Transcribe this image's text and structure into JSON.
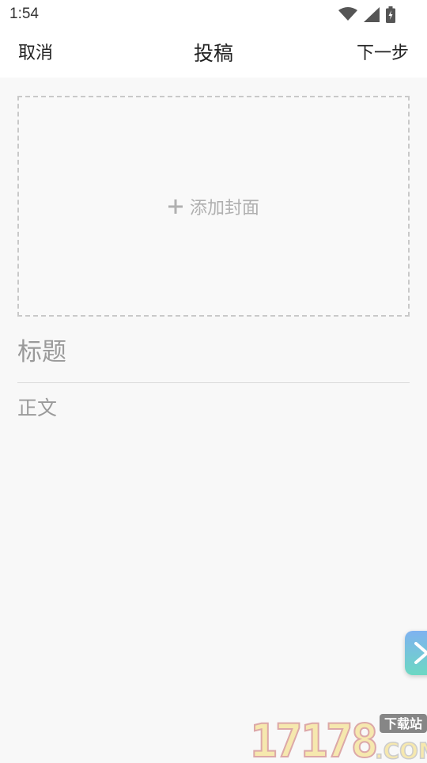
{
  "status_bar": {
    "time": "1:54",
    "icons": [
      "wifi-icon",
      "cell-signal-icon",
      "battery-charging-icon"
    ]
  },
  "header": {
    "cancel_label": "取消",
    "title": "投稿",
    "next_label": "下一步"
  },
  "cover": {
    "label": "添加封面",
    "icon": "plus-icon"
  },
  "editor": {
    "title_placeholder": "标题",
    "body_placeholder": "正文"
  },
  "floating_button": {
    "icon": "chevron-right-icon"
  },
  "watermark": {
    "text_main": "17178",
    "text_badge": "下载站",
    "text_com": ".COM"
  },
  "colors": {
    "background": "#f8f8f8",
    "header_bg": "#ffffff",
    "dashed_border": "#c9c9c9",
    "placeholder": "#9a9a9a"
  }
}
